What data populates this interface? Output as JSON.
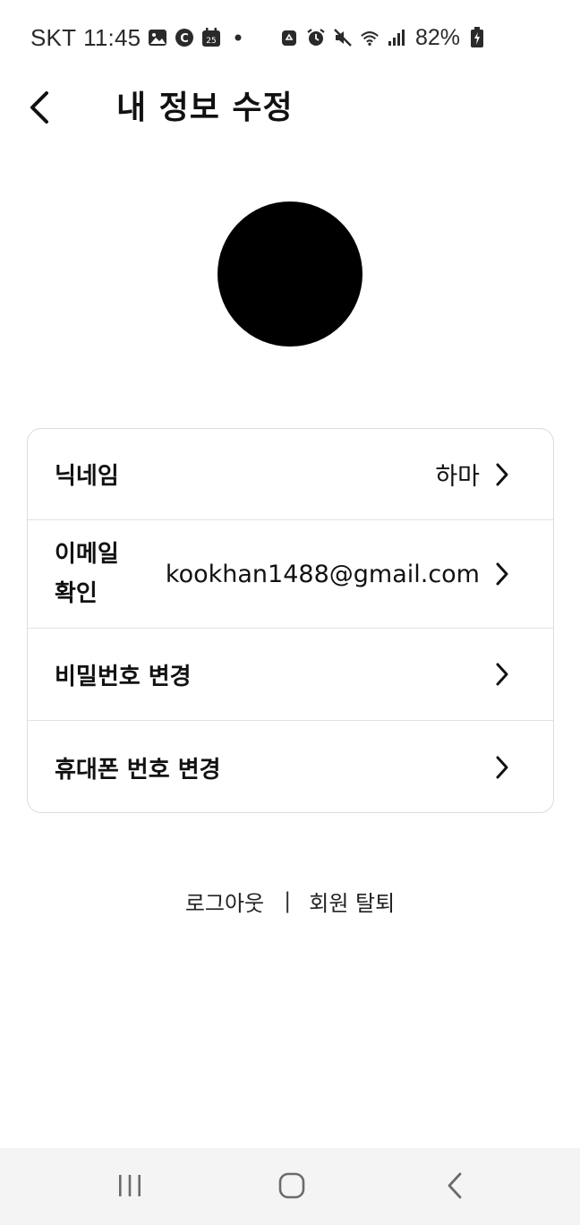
{
  "status_bar": {
    "carrier": "SKT",
    "time": "11:45",
    "calendar_day": "25",
    "battery_percent": "82%",
    "left_icons": [
      "gallery-icon",
      "c-app-icon",
      "calendar-icon",
      "dot-icon"
    ],
    "right_icons": [
      "recycle-icon",
      "alarm-icon",
      "mute-icon",
      "wifi-icon",
      "signal-icon",
      "battery-charging-icon"
    ]
  },
  "header": {
    "title": "내 정보 수정",
    "back_icon": "chevron-left-icon"
  },
  "profile": {
    "avatar_color": "#000000"
  },
  "settings": [
    {
      "label": "닉네임",
      "value": "하마"
    },
    {
      "label": "이메일 확인",
      "value": "kookhan1488@gmail.com"
    },
    {
      "label": "비밀번호 변경",
      "value": ""
    },
    {
      "label": "휴대폰 번호 변경",
      "value": ""
    }
  ],
  "footer": {
    "logout": "로그아웃",
    "separator": "|",
    "withdraw": "회원 탈퇴"
  },
  "nav_bar": {
    "buttons": [
      "recents-icon",
      "home-icon",
      "back-icon"
    ],
    "background": "#f4f4f4"
  }
}
